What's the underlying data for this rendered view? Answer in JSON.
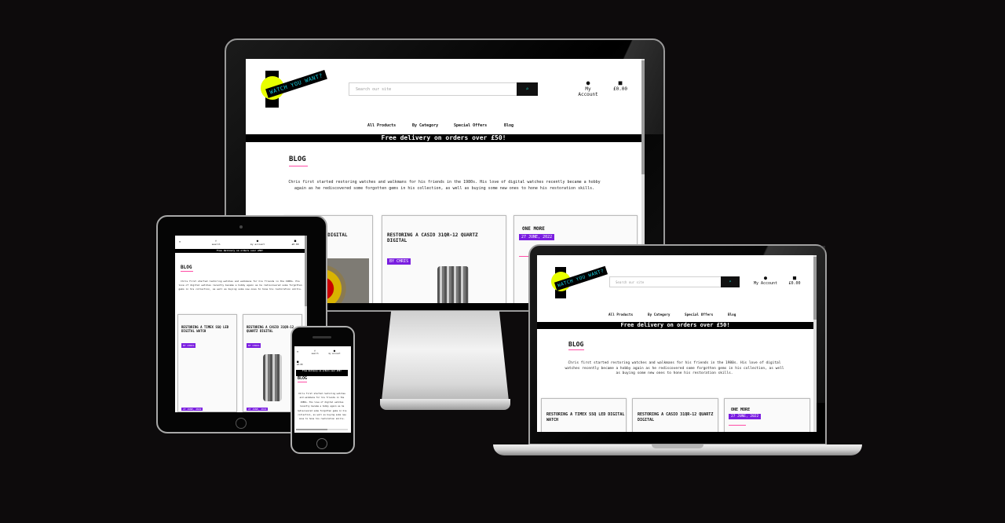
{
  "site": {
    "logo_text": "WATCH YOU WANT?",
    "search_placeholder": "Search our site",
    "search_icon": "search-icon",
    "account_label": "My Account",
    "account_icon": "user-icon",
    "basket_total": "£0.00",
    "basket_icon": "bag-icon",
    "nav": [
      "All Products",
      "By Category",
      "Special Offers",
      "Blog"
    ],
    "banner": "Free delivery on orders over £50!",
    "blog_heading": "BLOG",
    "intro": "Chris first started restoring watches and walkmans for his friends in the 1980s. His love of digital watches recently became a hobby again as he rediscovered some forgotten gems in his collection, as well as buying some new ones to hone his restoration skills.",
    "cards": [
      {
        "title": "RESTORING A TIMEX SSQ LED DIGITAL WATCH",
        "byline": "BY CHRIS"
      },
      {
        "title": "RESTORING A CASIO 31QR-12 QUARTZ DIGITAL",
        "byline": "BY CHRIS"
      },
      {
        "title": "ONE MORE",
        "date": "27 JUNE, 2022"
      }
    ],
    "imac_card1_title_partial": "D DIGITAL",
    "ipad_nav": [
      "search",
      "my account",
      "£0.00"
    ],
    "ipad_banner": "Free delivery on orders over £50!",
    "ipad_card_dates": [
      "27 JUNE, 2022",
      "27 JUNE, 2022"
    ],
    "iphone_nav": [
      "search",
      "my account",
      "£0.00"
    ],
    "iphone_intro": "Chris first started restoring watches and walkmans for his friends in the 1980s. His love of digital watches recently became a hobby again as he rediscovered some forgotten gems in his collection, as well as buying some new ones to hone his restoration skills."
  },
  "colors": {
    "background": "#0d0b0c",
    "logo_yellow": "#e8ff00",
    "logo_text": "#16c7d6",
    "accent_pink": "#ff4da6",
    "byline_purple": "#7a1ee0",
    "banner_black": "#000000"
  }
}
